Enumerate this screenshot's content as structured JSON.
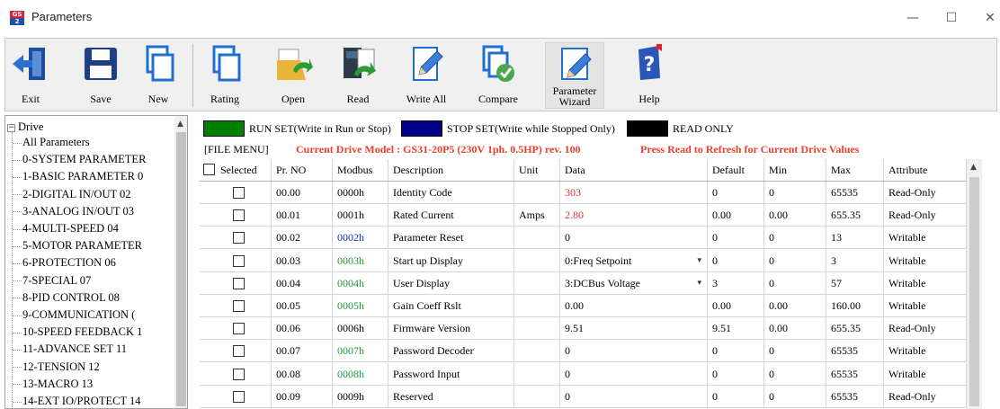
{
  "window": {
    "title": "Parameters",
    "app_icon": "gs-app-icon",
    "minimize": "—",
    "maximize": "☐",
    "close": "✕"
  },
  "toolbar": {
    "buttons": [
      {
        "label": "Exit",
        "icon": "exit-door-icon"
      },
      {
        "label": "Save",
        "icon": "floppy-save-icon"
      },
      {
        "label": "New",
        "icon": "new-document-icon"
      },
      {
        "label": "Rating",
        "icon": "rating-document-icon"
      },
      {
        "label": "Open",
        "icon": "open-folder-icon"
      },
      {
        "label": "Read",
        "icon": "read-drive-icon"
      },
      {
        "label": "Write All",
        "icon": "write-pencil-icon"
      },
      {
        "label": "Compare",
        "icon": "compare-check-icon"
      },
      {
        "label": "Parameter Wizard",
        "label_line1": "Parameter",
        "label_line2": "Wizard",
        "icon": "wizard-pencil-icon"
      },
      {
        "label": "Help",
        "icon": "help-question-icon"
      }
    ]
  },
  "tree": {
    "root": "Drive",
    "root_toggle": "−",
    "items": [
      "All Parameters",
      "0-SYSTEM PARAMETER",
      "1-BASIC PARAMETER 0",
      "2-DIGITAL IN/OUT  02",
      "3-ANALOG IN/OUT  03",
      "4-MULTI-SPEED  04",
      "5-MOTOR PARAMETER",
      "6-PROTECTION  06",
      "7-SPECIAL  07",
      "8-PID CONTROL  08",
      "9-COMMUNICATION  (",
      "10-SPEED FEEDBACK 1",
      "11-ADVANCE SET  11",
      "12-TENSION  12",
      "13-MACRO  13",
      "14-EXT IO/PROTECT 14"
    ]
  },
  "legend": {
    "run_set": "RUN SET(Write in Run or Stop)",
    "stop_set": "STOP SET(Write while Stopped Only)",
    "read_only": "READ ONLY",
    "run_color": "#008000",
    "stop_color": "#00008b",
    "readonly_color": "#000000"
  },
  "file_menu": "[FILE MENU]",
  "model_text": "Current Drive Model : GS31-20P5 (230V 1ph. 0.5HP) rev. 100",
  "refresh_text": "Press Read to Refresh for Current Drive Values",
  "table": {
    "headers": [
      "Selected",
      "Pr. NO",
      "Modbus",
      "Description",
      "Unit",
      "Data",
      "Default",
      "Min",
      "Max",
      "Attribute"
    ],
    "rows": [
      {
        "pr": "00.00",
        "modbus": "0000h",
        "modbus_color": "black",
        "desc": "Identity Code",
        "unit": "",
        "data": "303",
        "data_red": true,
        "dropdown": false,
        "default": "0",
        "min": "0",
        "max": "65535",
        "attr": "Read-Only"
      },
      {
        "pr": "00.01",
        "modbus": "0001h",
        "modbus_color": "black",
        "desc": "Rated Current",
        "unit": "Amps",
        "data": "2.80",
        "data_red": true,
        "dropdown": false,
        "default": "0.00",
        "min": "0.00",
        "max": "655.35",
        "attr": "Read-Only"
      },
      {
        "pr": "00.02",
        "modbus": "0002h",
        "modbus_color": "blue",
        "desc": "Parameter Reset",
        "unit": "",
        "data": "0",
        "data_red": false,
        "dropdown": false,
        "default": "0",
        "min": "0",
        "max": "13",
        "attr": "Writable"
      },
      {
        "pr": "00.03",
        "modbus": "0003h",
        "modbus_color": "green",
        "desc": "Start up Display",
        "unit": "",
        "data": "0:Freq Setpoint",
        "data_red": false,
        "dropdown": true,
        "default": "0",
        "min": "0",
        "max": "3",
        "attr": "Writable"
      },
      {
        "pr": "00.04",
        "modbus": "0004h",
        "modbus_color": "green",
        "desc": "User Display",
        "unit": "",
        "data": "3:DCBus Voltage",
        "data_red": false,
        "dropdown": true,
        "default": "3",
        "min": "0",
        "max": "57",
        "attr": "Writable"
      },
      {
        "pr": "00.05",
        "modbus": "0005h",
        "modbus_color": "green",
        "desc": "Gain Coeff Rslt",
        "unit": "",
        "data": "0.00",
        "data_red": false,
        "dropdown": false,
        "default": "0.00",
        "min": "0.00",
        "max": "160.00",
        "attr": "Writable"
      },
      {
        "pr": "00.06",
        "modbus": "0006h",
        "modbus_color": "black",
        "desc": "Firmware Version",
        "unit": "",
        "data": "9.51",
        "data_red": false,
        "dropdown": false,
        "default": "9.51",
        "min": "0.00",
        "max": "655.35",
        "attr": "Read-Only"
      },
      {
        "pr": "00.07",
        "modbus": "0007h",
        "modbus_color": "green",
        "desc": "Password Decoder",
        "unit": "",
        "data": "0",
        "data_red": false,
        "dropdown": false,
        "default": "0",
        "min": "0",
        "max": "65535",
        "attr": "Writable"
      },
      {
        "pr": "00.08",
        "modbus": "0008h",
        "modbus_color": "green",
        "desc": "Password Input",
        "unit": "",
        "data": "0",
        "data_red": false,
        "dropdown": false,
        "default": "0",
        "min": "0",
        "max": "65535",
        "attr": "Writable"
      },
      {
        "pr": "00.09",
        "modbus": "0009h",
        "modbus_color": "black",
        "desc": "Reserved",
        "unit": "",
        "data": "0",
        "data_red": false,
        "dropdown": false,
        "default": "0",
        "min": "0",
        "max": "65535",
        "attr": "Read-Only"
      }
    ]
  }
}
